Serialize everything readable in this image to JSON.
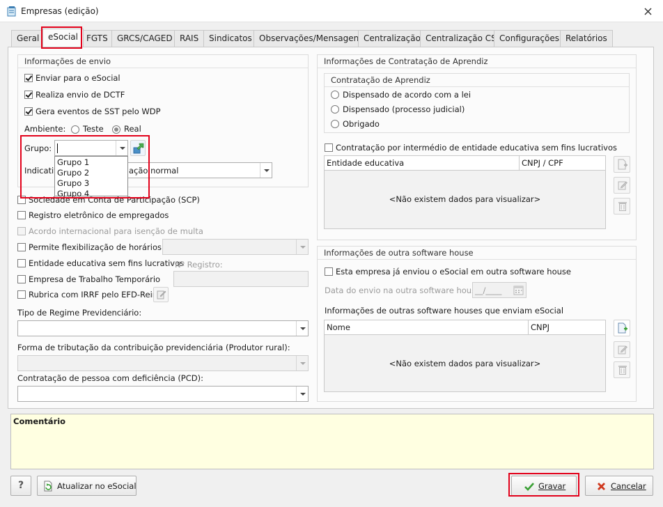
{
  "window": {
    "title": "Empresas (edição)"
  },
  "tabs": [
    "Geral",
    "eSocial",
    "FGTS",
    "GRCS/CAGED",
    "RAIS",
    "Sindicatos",
    "Observações/Mensagens",
    "Centralização",
    "Centralização CS",
    "Configurações",
    "Relatórios"
  ],
  "envio": {
    "title": "Informações de envio",
    "enviar": "Enviar para o eSocial",
    "dctf": "Realiza envio de DCTF",
    "sst": "Gera eventos de SST pelo WDP",
    "ambiente_label": "Ambiente:",
    "ambiente_teste": "Teste",
    "ambiente_real": "Real",
    "grupo_label": "Grupo:",
    "grupo_value": "",
    "grupo_options": [
      "Grupo 1",
      "Grupo 2",
      "Grupo 3",
      "Grupo 4"
    ],
    "indicativo_label": "Indicativ",
    "indicativo_value": "ação normal"
  },
  "left": {
    "scp": "Sociedade em Conta de Participação (SCP)",
    "registro": "Registro eletrônico de empregados",
    "acordo": "Acordo internacional para isenção de multa",
    "flex": "Permite flexibilização de horários",
    "entidade": "Entidade educativa sem fins lucrativos",
    "nregistro": "Nº Registro:",
    "temp": "Empresa de Trabalho Temporário",
    "rubrica": "Rubrica com IRRF pelo EFD-Reinf",
    "regime_label": "Tipo de Regime Previdenciário:",
    "tributacao_label": "Forma de tributação da contribuição previdenciária (Produtor rural):",
    "pcd_label": "Contratação de pessoa com deficiência (PCD):"
  },
  "aprendiz": {
    "title": "Informações de Contratação de Aprendiz",
    "sub": "Contratação de Aprendiz",
    "opt1": "Dispensado de acordo com a lei",
    "opt2": "Dispensado (processo judicial)",
    "opt3": "Obrigado",
    "intermedio": "Contratação por intermédio de entidade educativa sem fins lucrativos",
    "col1": "Entidade educativa",
    "col2": "CNPJ / CPF",
    "empty": "<Não existem dados para visualizar>"
  },
  "software": {
    "title": "Informações de outra software house",
    "enviou": "Esta empresa já enviou o eSocial em outra software house",
    "data_label": "Data do envio na outra software house:",
    "data_value": "__/____",
    "outras": "Informações de outras software houses que enviam eSocial",
    "col1": "Nome",
    "col2": "CNPJ",
    "empty": "<Não existem dados para visualizar>"
  },
  "comment": {
    "label": "Comentário"
  },
  "footer": {
    "help": "?",
    "atualizar": "Atualizar no eSocial",
    "gravar": "Gravar",
    "cancelar": "Cancelar"
  },
  "colors": {
    "highlight": "#e2001a",
    "comment_bg": "#ffffe1",
    "save_check": "#3aa035",
    "cancel_x": "#d0391f"
  }
}
